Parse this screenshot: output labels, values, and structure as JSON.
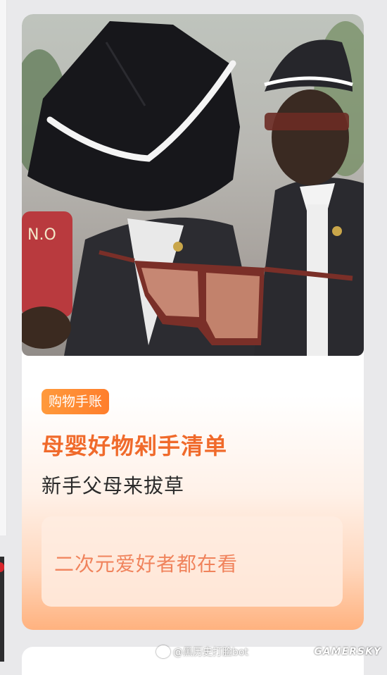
{
  "card": {
    "badge": "购物手账",
    "title": "母婴好物剁手清单",
    "subtitle": "新手父母来拔草",
    "tag": "二次元爱好者都在看"
  },
  "watermark": {
    "handle": "@黑历史打脸bot",
    "site": "GAMERSKY"
  },
  "colors": {
    "accent": "#f06a2b",
    "badge_bg": "#ff8a33",
    "tag_text": "#f0835c"
  }
}
